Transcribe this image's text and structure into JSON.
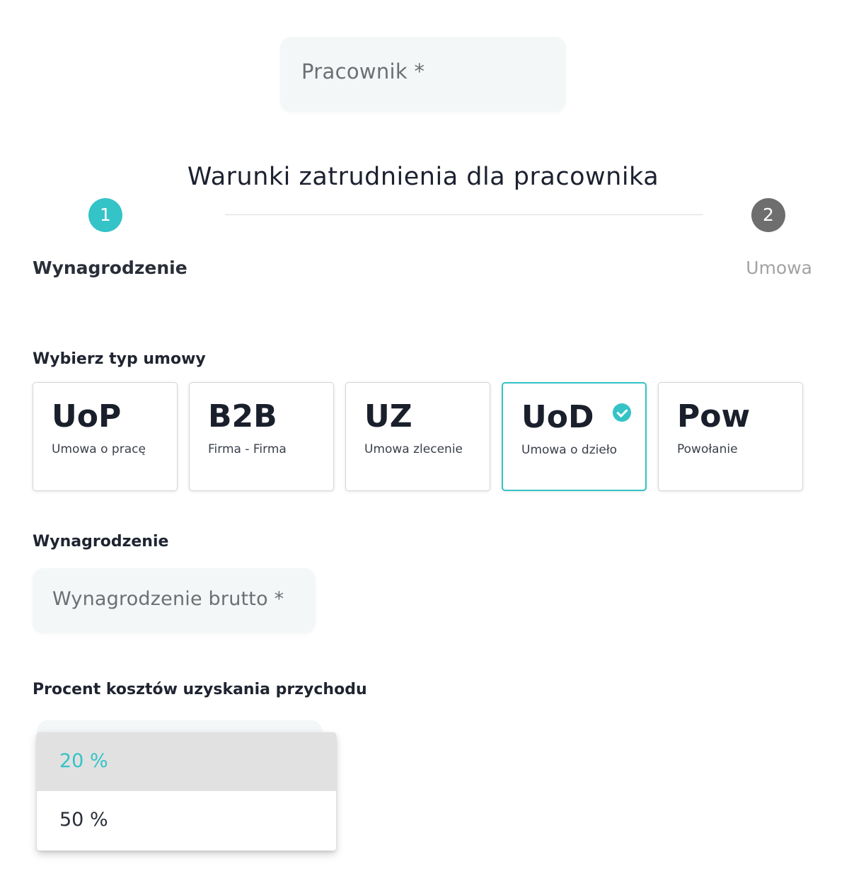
{
  "employee_select": {
    "label": "Pracownik *"
  },
  "section": {
    "title": "Warunki zatrudnienia dla pracownika"
  },
  "stepper": {
    "steps": [
      {
        "number": "1",
        "label": "Wynagrodzenie"
      },
      {
        "number": "2",
        "label": "Umowa"
      }
    ]
  },
  "contract_type": {
    "heading": "Wybierz typ umowy",
    "options": [
      {
        "code": "UoP",
        "description": "Umowa o pracę"
      },
      {
        "code": "B2B",
        "description": "Firma - Firma"
      },
      {
        "code": "UZ",
        "description": "Umowa zlecenie"
      },
      {
        "code": "UoD",
        "description": "Umowa o dzieło"
      },
      {
        "code": "Pow",
        "description": "Powołanie"
      }
    ],
    "selected": "UoD"
  },
  "salary": {
    "heading": "Wynagrodzenie",
    "placeholder": "Wynagrodzenie brutto *"
  },
  "cost_percent": {
    "heading": "Procent kosztów uzyskania przychodu",
    "options": [
      "20 %",
      "50 %"
    ],
    "highlighted": "20 %"
  },
  "colors": {
    "accent": "#34c3c7",
    "inactive_step": "#6e6e6e",
    "field_background": "#f3f7f8"
  }
}
